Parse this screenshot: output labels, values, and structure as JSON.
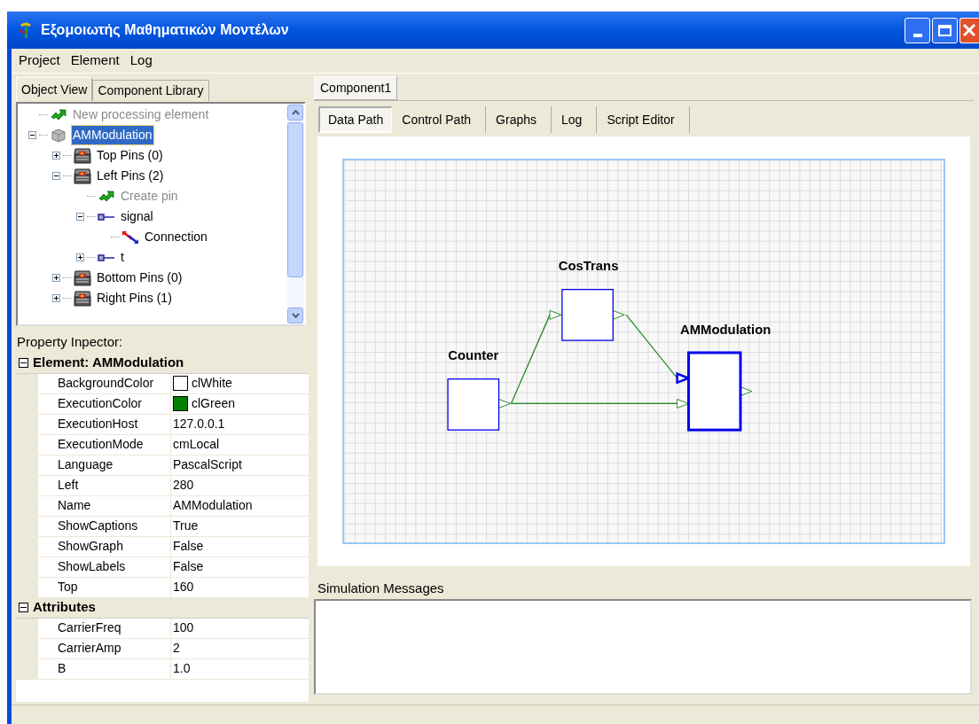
{
  "window": {
    "title": "Εξομοιωτής Μαθηματικών Μοντέλων"
  },
  "menu": [
    "Project",
    "Element",
    "Log"
  ],
  "left_tabs": [
    {
      "label": "Object View",
      "selected": true
    },
    {
      "label": "Component Library",
      "selected": false
    }
  ],
  "tree": [
    {
      "label": "New processing element",
      "kind": "action",
      "selected": false
    },
    {
      "label": "AMModulation",
      "kind": "element",
      "selected": true,
      "expanded": true,
      "children": [
        {
          "label": "Top Pins (0)",
          "kind": "pins",
          "selected": false,
          "expanded": false
        },
        {
          "label": "Left Pins (2)",
          "kind": "pins",
          "selected": false,
          "expanded": true,
          "children": [
            {
              "label": "Create pin",
              "kind": "action",
              "selected": false
            },
            {
              "label": "signal",
              "kind": "pin",
              "selected": false,
              "expanded": true,
              "children": [
                {
                  "label": "Connection",
                  "kind": "connection",
                  "selected": false
                }
              ]
            },
            {
              "label": "t",
              "kind": "pin",
              "selected": false,
              "expanded": false
            }
          ]
        },
        {
          "label": "Bottom Pins (0)",
          "kind": "pins",
          "selected": false,
          "expanded": false
        },
        {
          "label": "Right Pins (1)",
          "kind": "pins",
          "selected": false,
          "expanded": false
        }
      ]
    }
  ],
  "property_inspector": {
    "title": "Property Inpector:",
    "sections": [
      {
        "title": "Element: AMModulation",
        "expanded": true,
        "rows": [
          {
            "name": "BackgroundColor",
            "value": "clWhite",
            "color": "#ffffff"
          },
          {
            "name": "ExecutionColor",
            "value": "clGreen",
            "color": "#008000"
          },
          {
            "name": "ExecutionHost",
            "value": "127.0.0.1"
          },
          {
            "name": "ExecutionMode",
            "value": "cmLocal"
          },
          {
            "name": "Language",
            "value": "PascalScript"
          },
          {
            "name": "Left",
            "value": "280"
          },
          {
            "name": "Name",
            "value": "AMModulation"
          },
          {
            "name": "ShowCaptions",
            "value": "True"
          },
          {
            "name": "ShowGraph",
            "value": "False"
          },
          {
            "name": "ShowLabels",
            "value": "False"
          },
          {
            "name": "Top",
            "value": "160"
          }
        ]
      },
      {
        "title": "Attributes",
        "expanded": true,
        "rows": [
          {
            "name": "CarrierFreq",
            "value": "100"
          },
          {
            "name": "CarrierAmp",
            "value": "2"
          },
          {
            "name": "B",
            "value": "1.0"
          }
        ]
      }
    ]
  },
  "doc_tabs": [
    {
      "label": "Component1",
      "selected": true
    }
  ],
  "view_tabs": [
    {
      "label": "Data Path",
      "selected": true
    },
    {
      "label": "Control Path",
      "selected": false
    },
    {
      "label": "Graphs",
      "selected": false
    },
    {
      "label": "Log",
      "selected": false
    },
    {
      "label": "Script Editor",
      "selected": false
    }
  ],
  "diagram": {
    "nodes": [
      {
        "label": "Counter",
        "selected": false
      },
      {
        "label": "CosTrans",
        "selected": false
      },
      {
        "label": "AMModulation",
        "selected": true
      }
    ]
  },
  "messages": {
    "title": "Simulation Messages"
  }
}
